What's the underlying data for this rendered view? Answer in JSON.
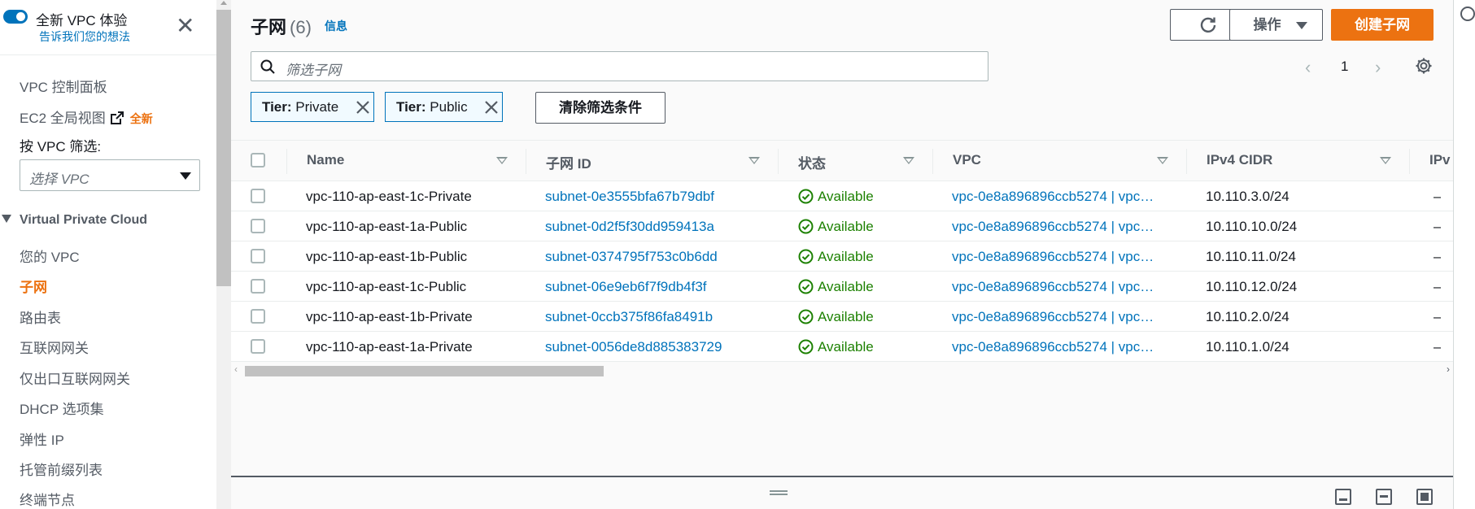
{
  "sidebar": {
    "experience_title": "全新 VPC 体验",
    "experience_feedback_link": "告诉我们您的想法",
    "vpc_dashboard": "VPC 控制面板",
    "ec2_global_view": "EC2 全局视图",
    "new_badge": "全新",
    "filter_by_vpc_label": "按 VPC 筛选:",
    "vpc_select_placeholder": "选择 VPC",
    "section_title": "Virtual Private Cloud",
    "items": [
      {
        "label": "您的 VPC",
        "active": false
      },
      {
        "label": "子网",
        "active": true
      },
      {
        "label": "路由表",
        "active": false
      },
      {
        "label": "互联网网关",
        "active": false
      },
      {
        "label": "仅出口互联网网关",
        "active": false
      },
      {
        "label": "DHCP 选项集",
        "active": false
      },
      {
        "label": "弹性 IP",
        "active": false
      },
      {
        "label": "托管前缀列表",
        "active": false
      },
      {
        "label": "终端节点",
        "active": false
      }
    ]
  },
  "header": {
    "title": "子网",
    "count": "(6)",
    "info_link": "信息",
    "actions_label": "操作",
    "create_label": "创建子网"
  },
  "search": {
    "placeholder": "筛选子网"
  },
  "pagination": {
    "current_page": "1"
  },
  "filters": [
    {
      "key": "Tier:",
      "value": "Private"
    },
    {
      "key": "Tier:",
      "value": "Public"
    }
  ],
  "clear_filters_label": "清除筛选条件",
  "table": {
    "columns": [
      "Name",
      "子网 ID",
      "状态",
      "VPC",
      "IPv4 CIDR",
      "IPv"
    ],
    "rows": [
      {
        "name": "vpc-110-ap-east-1c-Private",
        "subnet_id": "subnet-0e3555bfa67b79dbf",
        "state": "Available",
        "vpc": "vpc-0e8a896896ccb5274 | vpc…",
        "cidr": "10.110.3.0/24",
        "ipv6": "–"
      },
      {
        "name": "vpc-110-ap-east-1a-Public",
        "subnet_id": "subnet-0d2f5f30dd959413a",
        "state": "Available",
        "vpc": "vpc-0e8a896896ccb5274 | vpc…",
        "cidr": "10.110.10.0/24",
        "ipv6": "–"
      },
      {
        "name": "vpc-110-ap-east-1b-Public",
        "subnet_id": "subnet-0374795f753c0b6dd",
        "state": "Available",
        "vpc": "vpc-0e8a896896ccb5274 | vpc…",
        "cidr": "10.110.11.0/24",
        "ipv6": "–"
      },
      {
        "name": "vpc-110-ap-east-1c-Public",
        "subnet_id": "subnet-06e9eb6f7f9db4f3f",
        "state": "Available",
        "vpc": "vpc-0e8a896896ccb5274 | vpc…",
        "cidr": "10.110.12.0/24",
        "ipv6": "–"
      },
      {
        "name": "vpc-110-ap-east-1b-Private",
        "subnet_id": "subnet-0ccb375f86fa8491b",
        "state": "Available",
        "vpc": "vpc-0e8a896896ccb5274 | vpc…",
        "cidr": "10.110.2.0/24",
        "ipv6": "–"
      },
      {
        "name": "vpc-110-ap-east-1a-Private",
        "subnet_id": "subnet-0056de8d885383729",
        "state": "Available",
        "vpc": "vpc-0e8a896896ccb5274 | vpc…",
        "cidr": "10.110.1.0/24",
        "ipv6": "–"
      }
    ]
  },
  "colors": {
    "accent": "#ec7211",
    "link": "#0073bb",
    "success": "#1d8102"
  },
  "icons": {
    "close": "close-icon",
    "refresh": "refresh-icon",
    "search": "search-icon",
    "settings": "gear-icon",
    "external": "external-link-icon",
    "status": "check-circle-icon"
  }
}
